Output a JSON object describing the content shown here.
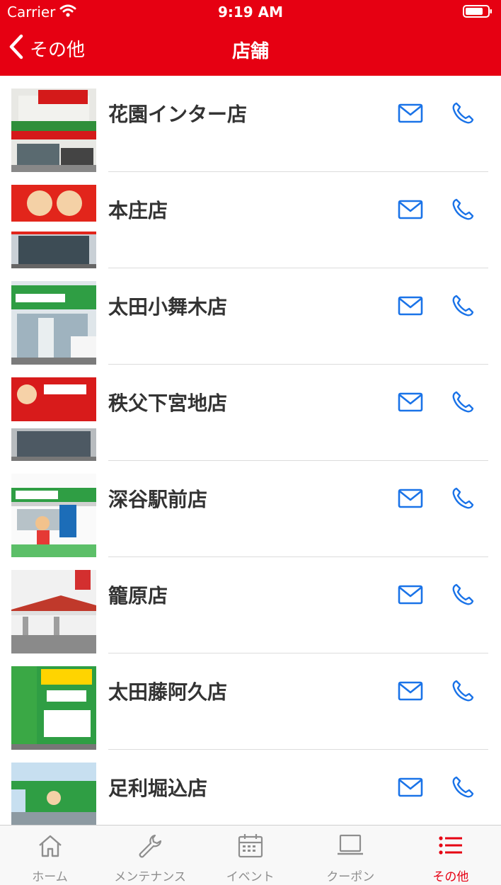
{
  "status_bar": {
    "carrier": "Carrier",
    "time": "9:19 AM"
  },
  "nav": {
    "back_label": "その他",
    "title": "店舗"
  },
  "colors": {
    "brand_red": "#e60012",
    "icon_blue": "#1a73e8",
    "tab_inactive": "#8e8e8e"
  },
  "stores": [
    {
      "name": "花園インター店",
      "photo": "storefront-photo"
    },
    {
      "name": "本庄店",
      "photo": "storefront-photo"
    },
    {
      "name": "太田小舞木店",
      "photo": "storefront-photo"
    },
    {
      "name": "秩父下宮地店",
      "photo": "storefront-photo"
    },
    {
      "name": "深谷駅前店",
      "photo": "storefront-photo"
    },
    {
      "name": "籠原店",
      "photo": "storefront-photo"
    },
    {
      "name": "太田藤阿久店",
      "photo": "storefront-photo"
    },
    {
      "name": "足利堀込店",
      "photo": "storefront-photo"
    }
  ],
  "tabs": [
    {
      "label": "ホーム",
      "icon": "home-icon",
      "active": false
    },
    {
      "label": "メンテナンス",
      "icon": "wrench-icon",
      "active": false
    },
    {
      "label": "イベント",
      "icon": "calendar-icon",
      "active": false
    },
    {
      "label": "クーポン",
      "icon": "laptop-icon",
      "active": false
    },
    {
      "label": "その他",
      "icon": "list-icon",
      "active": true
    }
  ]
}
